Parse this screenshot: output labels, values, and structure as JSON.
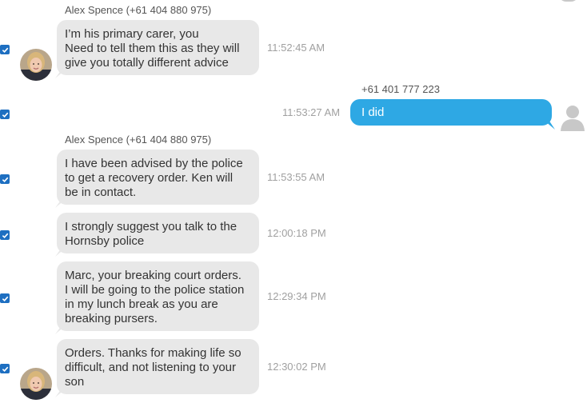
{
  "conversation": {
    "contact_sender": "Alex Spence (+61 404 880 975)",
    "own_sender": "+61 401 777 223",
    "messages": [
      {
        "direction": "incoming",
        "lines": [
          "I’m his primary carer, you",
          "Need to tell them this as they will",
          "give you totally different advice"
        ],
        "time": "11:52:45 AM",
        "selected": true
      },
      {
        "direction": "outgoing",
        "lines": [
          "I did"
        ],
        "time": "11:53:27 AM",
        "selected": true
      },
      {
        "direction": "incoming",
        "lines": [
          "I have been advised by the police",
          "to get a recovery order. Ken will",
          "be in contact."
        ],
        "time": "11:53:55 AM",
        "selected": true
      },
      {
        "direction": "incoming",
        "lines": [
          "I strongly suggest you talk to the",
          "Hornsby police"
        ],
        "time": "12:00:18 PM",
        "selected": true
      },
      {
        "direction": "incoming",
        "lines": [
          "Marc, your breaking court orders.",
          "I will be going to the police station",
          "in my lunch break as you are",
          "breaking pursers."
        ],
        "time": "12:29:34 PM",
        "selected": true
      },
      {
        "direction": "incoming",
        "lines": [
          "Orders. Thanks for making life so",
          "difficult, and not listening to your",
          "son"
        ],
        "time": "12:30:02 PM",
        "selected": true
      }
    ]
  },
  "icons": {
    "checkbox": "checkbox-checked-icon",
    "contact_avatar": "contact-avatar",
    "own_avatar": "default-user-silhouette-icon"
  },
  "colors": {
    "incoming_bubble": "#e8e8e8",
    "outgoing_bubble": "#2ea8e4",
    "checkbox": "#1e6fc1",
    "timestamp": "#a0a0a0"
  }
}
